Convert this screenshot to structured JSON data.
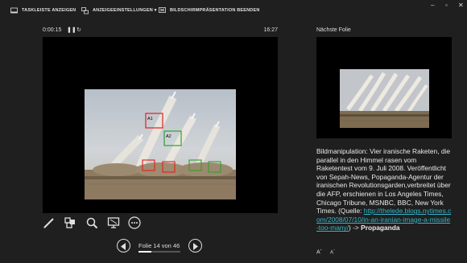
{
  "toolbar": {
    "taskbar_label": "TASKLEISTE ANZEIGEN",
    "display_settings_label": "ANZEIGEEINSTELLUNGEN ▾",
    "end_show_label": "BILDSCHIRMPRÄSENTATION BEENDEN",
    "window_controls": [
      "–",
      "▫",
      "✕"
    ]
  },
  "timer": {
    "elapsed": "0:00:15",
    "pause_icon": "pause-icon",
    "reset_icon": "reset-icon",
    "clock": "16:27"
  },
  "main_slide": {
    "callouts": [
      "A1",
      "A2"
    ]
  },
  "tools": [
    "pen-icon",
    "slide-grid-icon",
    "zoom-icon",
    "screen-icon",
    "more-icon"
  ],
  "navigation": {
    "counter": "Folie 14 von 46",
    "current": 14,
    "total": 46
  },
  "next_slide": {
    "label": "Nächste Folie"
  },
  "notes": {
    "text": "Bildmanipulation: Vier iranische Raketen, die parallel in den Himmel rasen vom Raketentest vom 9. Juli 2008. Veröffentlicht von Sepah-News, Popaganda-Agentur der iranischen Revolutionsgarden,verbreitet über die AFP,  erschienen in Los Angeles Times, Chicago Tribune, MSNBC, BBC, New York Times. (Quelle:",
    "link": "http://thelede.blogs.nytimes.com/2008/07/10/in-an-iranian-image-a-missile-too-many/",
    "link_suffix": ") -> ",
    "emphasis": "Propaganda"
  },
  "font_controls": [
    "A",
    "A"
  ]
}
